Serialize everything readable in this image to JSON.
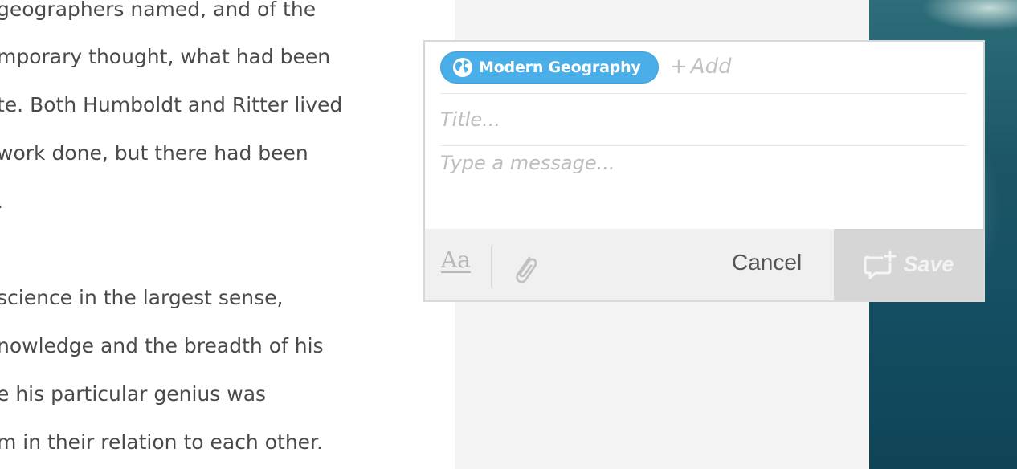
{
  "reading": {
    "lines": [
      "geographers named, and of the",
      "mporary thought, what had been",
      "te. Both Humboldt and Ritter lived",
      "work done, but there had been",
      ".",
      "science in the largest sense,",
      "nowledge and the breadth of his",
      "e his particular genius was",
      "m in their relation to each other."
    ]
  },
  "annotation": {
    "tag": {
      "label": "Modern Geography",
      "icon": "globe-icon",
      "color": "#4aafe9"
    },
    "add_tag_label": "Add",
    "title_placeholder": "Title...",
    "message_placeholder": "Type a message...",
    "toolbar": {
      "format_label": "Aa",
      "attach_icon": "paperclip-icon",
      "cancel_label": "Cancel",
      "save_label": "Save",
      "save_icon": "comment-add-icon"
    }
  }
}
